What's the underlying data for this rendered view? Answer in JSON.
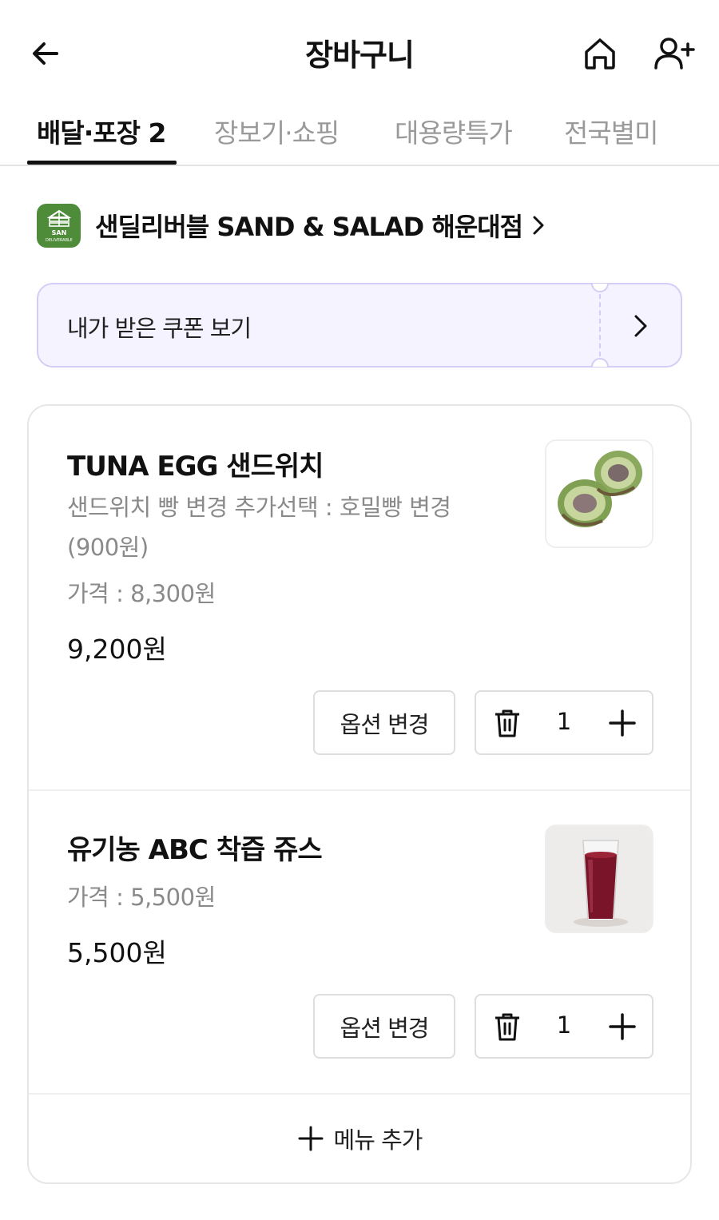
{
  "header": {
    "title": "장바구니",
    "back_icon": "arrow-left-icon",
    "home_icon": "home-icon",
    "user_add_icon": "user-plus-icon"
  },
  "tabs": [
    {
      "label": "배달·포장 2",
      "active": true
    },
    {
      "label": "장보기·쇼핑",
      "active": false
    },
    {
      "label": "대용량특가",
      "active": false
    },
    {
      "label": "전국별미",
      "active": false
    }
  ],
  "store": {
    "name": "샌딜리버블 SAND & SALAD 해운대점",
    "logo_text": "SAN DELIVERABLE",
    "logo_color": "#4e8c3a"
  },
  "coupon": {
    "label": "내가 받은 쿠폰 보기"
  },
  "cart_items": [
    {
      "name": "TUNA EGG 샌드위치",
      "option": "샌드위치 빵 변경 추가선택 : 호밀빵 변경 (900원)",
      "price_label": "가격 : 8,300원",
      "total": "9,200원",
      "option_button": "옵션 변경",
      "quantity": "1",
      "image": "tuna-egg-sandwich"
    },
    {
      "name": "유기농 ABC 착즙 쥬스",
      "price_label": "가격 : 5,500원",
      "total": "5,500원",
      "option_button": "옵션 변경",
      "quantity": "1",
      "image": "abc-juice"
    }
  ],
  "add_menu": {
    "label": "메뉴 추가"
  },
  "colors": {
    "coupon_bg": "#f5f3ff",
    "coupon_border": "#d4cdf6",
    "text_primary": "#111111",
    "text_secondary": "#8a8a8a"
  }
}
